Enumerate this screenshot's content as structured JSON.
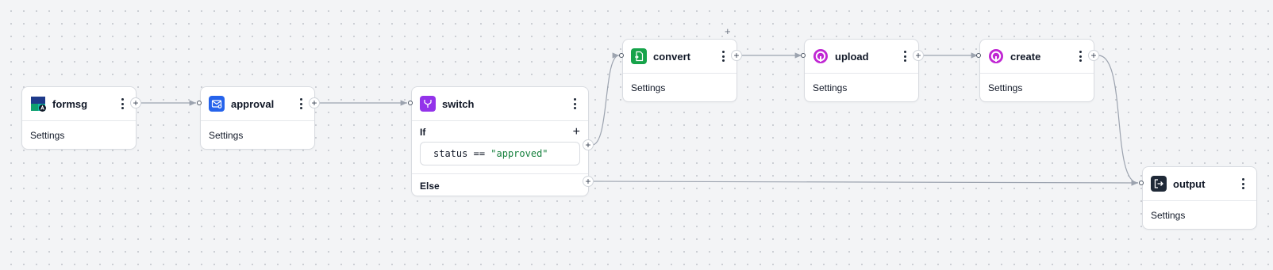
{
  "nodes": {
    "formsg": {
      "title": "formsg",
      "settings": "Settings"
    },
    "approval": {
      "title": "approval",
      "settings": "Settings"
    },
    "switch": {
      "title": "switch",
      "if_label": "If",
      "else_label": "Else",
      "condition": {
        "lhs": "status",
        "op": "==",
        "rhs": "\"approved\""
      }
    },
    "convert": {
      "title": "convert",
      "settings": "Settings"
    },
    "upload": {
      "title": "upload",
      "settings": "Settings"
    },
    "create": {
      "title": "create",
      "settings": "Settings"
    },
    "output": {
      "title": "output",
      "settings": "Settings"
    }
  },
  "controls": {
    "plus": "+",
    "add_above_convert": "+"
  },
  "icons": {
    "formsg": "formsg-logo-icon",
    "approval": "mail-check-icon",
    "switch": "branch-icon",
    "convert": "file-convert-icon",
    "upload": "pipedream-icon",
    "create": "pipedream-icon",
    "output": "exit-icon"
  },
  "colors": {
    "approval": "#2563eb",
    "switch": "#9333ea",
    "convert": "#16a34a",
    "pipedream": "#c026d3",
    "output": "#1f2937",
    "string_literal": "#15803d"
  }
}
